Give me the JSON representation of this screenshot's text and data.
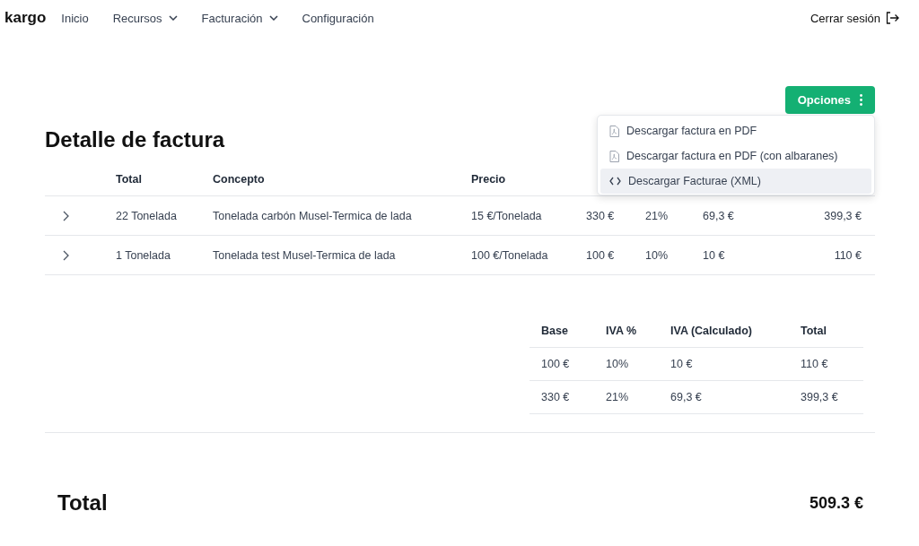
{
  "nav": {
    "logo": "kargo",
    "items": [
      {
        "label": "Inicio",
        "dropdown": false
      },
      {
        "label": "Recursos",
        "dropdown": true
      },
      {
        "label": "Facturación",
        "dropdown": true
      },
      {
        "label": "Configuración",
        "dropdown": false
      }
    ],
    "logout": "Cerrar sesión"
  },
  "options_button": "Opciones",
  "options_menu": [
    {
      "label": "Descargar factura en PDF",
      "kind": "pdf",
      "selected": false
    },
    {
      "label": "Descargar factura en PDF (con albaranes)",
      "kind": "pdf",
      "selected": false
    },
    {
      "label": "Descargar Facturae (XML)",
      "kind": "code",
      "selected": true
    }
  ],
  "title": "Detalle de factura",
  "lines_table": {
    "columns": [
      "Total",
      "Concepto",
      "Precio"
    ],
    "rows": [
      {
        "expanded": false,
        "cells": [
          "22 Tonelada",
          "Tonelada carbón Musel-Termica de lada",
          "15 €/Tonelada",
          "330 €",
          "21%",
          "69,3 €",
          "399,3 €"
        ]
      },
      {
        "expanded": false,
        "cells": [
          "1 Tonelada",
          "Tonelada test Musel-Termica de lada",
          "100 €/Tonelada",
          "100 €",
          "10%",
          "10 €",
          "110 €"
        ]
      }
    ]
  },
  "tax_table": {
    "columns": [
      "Base",
      "IVA %",
      "IVA (Calculado)",
      "Total"
    ],
    "rows": [
      [
        "100 €",
        "10%",
        "10 €",
        "110 €"
      ],
      [
        "330 €",
        "21%",
        "69,3 €",
        "399,3 €"
      ]
    ]
  },
  "total": {
    "label": "Total",
    "value": "509.3 €"
  }
}
